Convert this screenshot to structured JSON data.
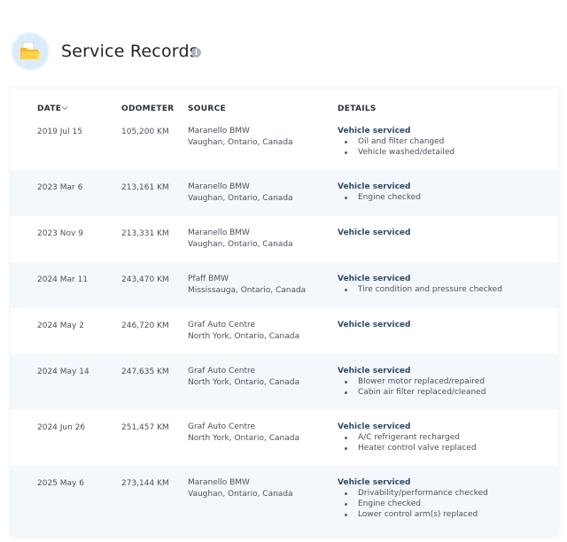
{
  "header": {
    "title": "Service Records",
    "info_icon": "info-icon",
    "folder_icon": "folder-icon"
  },
  "table": {
    "columns": {
      "date": "DATE",
      "odometer": "ODOMETER",
      "source": "SOURCE",
      "details": "DETAILS"
    },
    "rows": [
      {
        "date": "2019 Jul 15",
        "odometer": "105,200 KM",
        "source_name": "Maranello BMW",
        "source_location": "Vaughan, Ontario, Canada",
        "details_title": "Vehicle serviced",
        "details_items": [
          "Oil and filter changed",
          "Vehicle washed/detailed"
        ]
      },
      {
        "date": "2023 Mar 6",
        "odometer": "213,161 KM",
        "source_name": "Maranello BMW",
        "source_location": "Vaughan, Ontario, Canada",
        "details_title": "Vehicle serviced",
        "details_items": [
          "Engine checked"
        ]
      },
      {
        "date": "2023 Nov 9",
        "odometer": "213,331 KM",
        "source_name": "Maranello BMW",
        "source_location": "Vaughan, Ontario, Canada",
        "details_title": "Vehicle serviced",
        "details_items": []
      },
      {
        "date": "2024 Mar 11",
        "odometer": "243,470 KM",
        "source_name": "Pfaff BMW",
        "source_location": "Mississauga, Ontario, Canada",
        "details_title": "Vehicle serviced",
        "details_items": [
          "Tire condition and pressure checked"
        ]
      },
      {
        "date": "2024 May 2",
        "odometer": "246,720 KM",
        "source_name": "Graf Auto Centre",
        "source_location": "North York, Ontario, Canada",
        "details_title": "Vehicle serviced",
        "details_items": []
      },
      {
        "date": "2024 May 14",
        "odometer": "247,635 KM",
        "source_name": "Graf Auto Centre",
        "source_location": "North York, Ontario, Canada",
        "details_title": "Vehicle serviced",
        "details_items": [
          "Blower motor replaced/repaired",
          "Cabin air filter replaced/cleaned"
        ]
      },
      {
        "date": "2024 Jun 26",
        "odometer": "251,457 KM",
        "source_name": "Graf Auto Centre",
        "source_location": "North York, Ontario, Canada",
        "details_title": "Vehicle serviced",
        "details_items": [
          "A/C refrigerant recharged",
          "Heater control valve replaced"
        ]
      },
      {
        "date": "2025 May 6",
        "odometer": "273,144 KM",
        "source_name": "Maranello BMW",
        "source_location": "Vaughan, Ontario, Canada",
        "details_title": "Vehicle serviced",
        "details_items": [
          "Drivability/performance checked",
          "Engine checked",
          "Lower control arm(s) replaced"
        ]
      }
    ]
  }
}
